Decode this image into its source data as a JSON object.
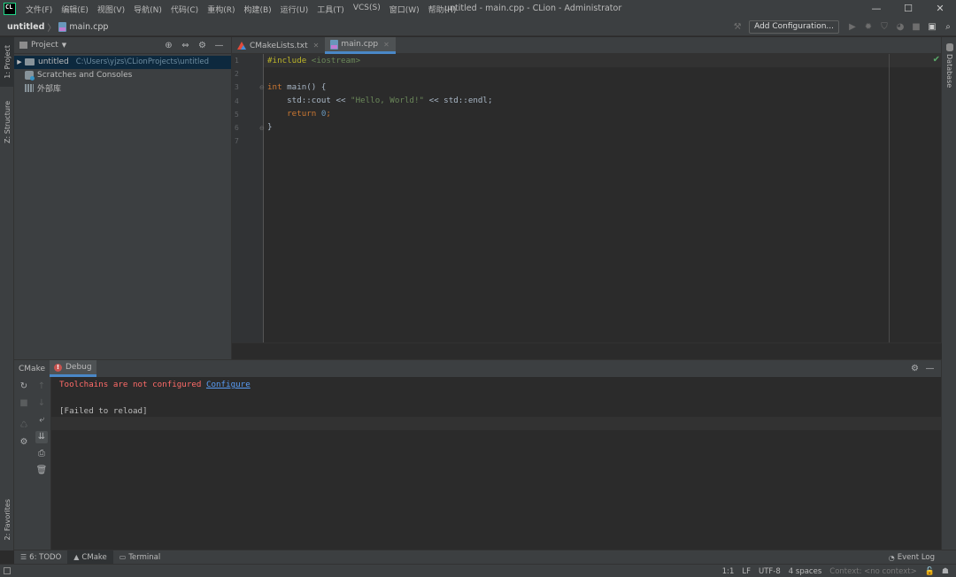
{
  "window": {
    "logo": "CL",
    "title": "untitled - main.cpp - CLion - Administrator",
    "menu": [
      "文件(F)",
      "编辑(E)",
      "视图(V)",
      "导航(N)",
      "代码(C)",
      "重构(R)",
      "构建(B)",
      "运行(U)",
      "工具(T)",
      "VCS(S)",
      "窗口(W)",
      "帮助(H)"
    ],
    "controls": {
      "minimize": "—",
      "maximize": "☐",
      "close": "✕"
    }
  },
  "navbar": {
    "project": "untitled",
    "file": "main.cpp",
    "add_config": "Add Configuration..."
  },
  "left_strip": {
    "project_tab": "1: Project",
    "structure_tab": "Z: Structure",
    "favorites_tab": "2: Favorites"
  },
  "right_strip": {
    "database_tab": "Database"
  },
  "project_panel": {
    "title": "Project",
    "tree": [
      {
        "name": "untitled",
        "path": "C:\\Users\\yjzs\\CLionProjects\\untitled",
        "selected": true
      },
      {
        "name": "Scratches and Consoles"
      },
      {
        "name": "外部库"
      }
    ]
  },
  "editor": {
    "tabs": [
      {
        "label": "CMakeLists.txt",
        "active": false
      },
      {
        "label": "main.cpp",
        "active": true
      }
    ],
    "line_numbers": [
      "1",
      "2",
      "3",
      "4",
      "5",
      "6",
      "7"
    ],
    "code": {
      "l1_directive": "#include",
      "l1_header": " <iostream>",
      "l3_kw": "int",
      "l3_rest": " main() {",
      "l4_a": "    std::cout << ",
      "l4_str": "\"Hello, World!\"",
      "l4_b": " << std::endl;",
      "l5_kw": "    return",
      "l5_sp": " ",
      "l5_num": "0",
      "l5_end": ";",
      "l6": "}"
    }
  },
  "bottom_panel": {
    "tabs": [
      {
        "label": "CMake",
        "active": false
      },
      {
        "label": "Debug",
        "active": true
      }
    ],
    "console": {
      "error": "Toolchains are not configured ",
      "link": "Configure",
      "status": "[Failed to reload]"
    }
  },
  "tool_tabs": {
    "todo": "6: TODO",
    "cmake": "CMake",
    "terminal": "Terminal",
    "event_log": "Event Log"
  },
  "status_bar": {
    "position": "1:1",
    "line_sep": "LF",
    "encoding": "UTF-8",
    "indent": "4 spaces",
    "context": "Context: <no context>"
  }
}
